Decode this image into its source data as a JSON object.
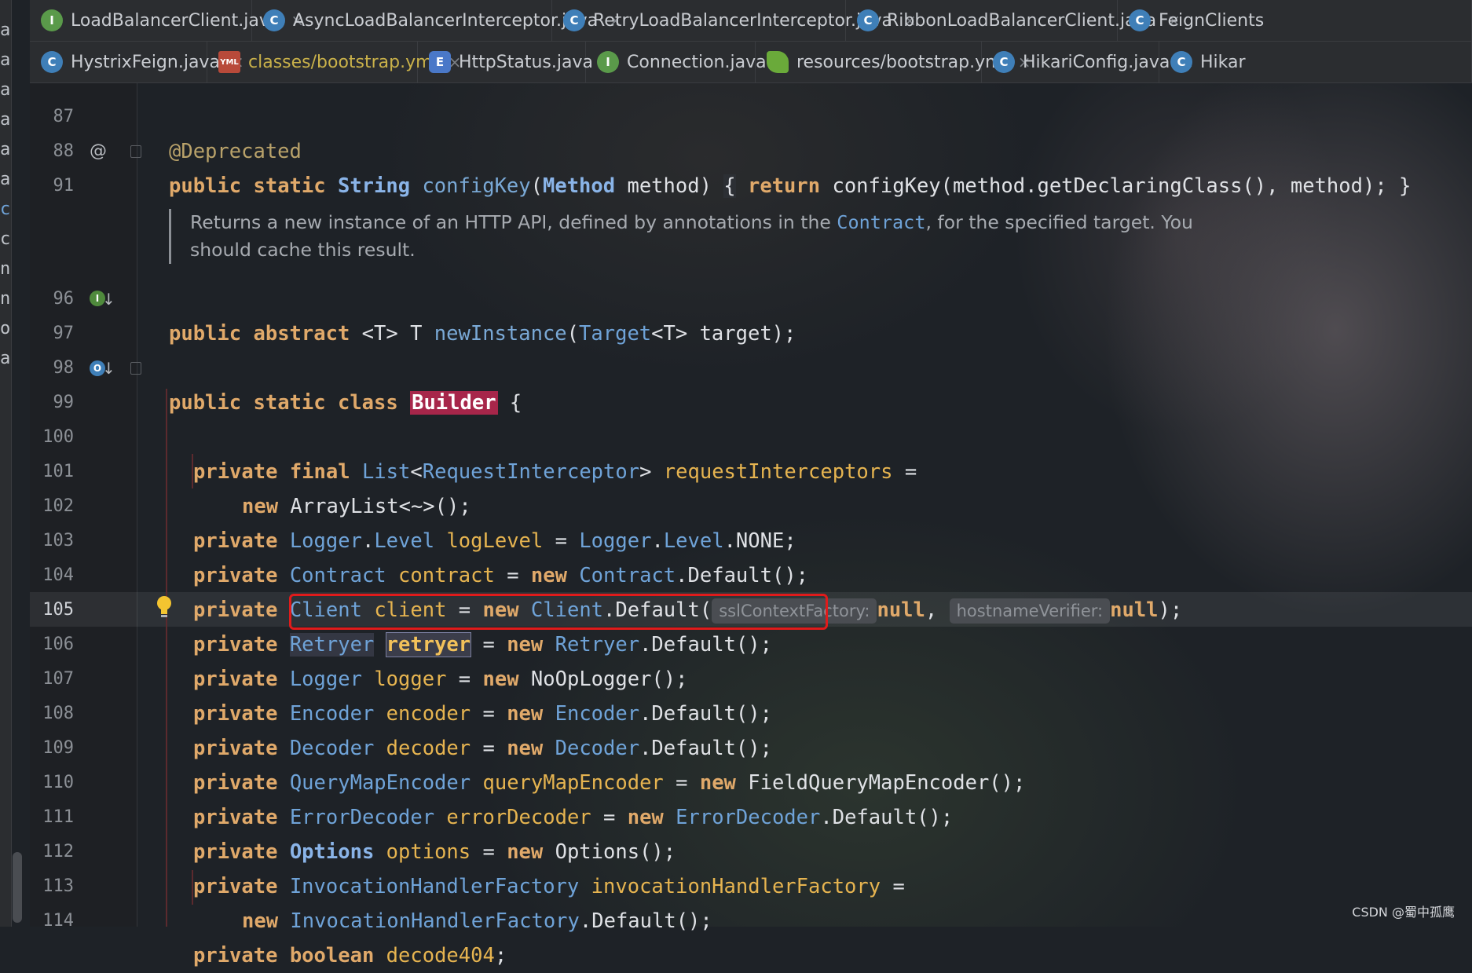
{
  "tabs_row1": [
    {
      "label": "LoadBalancerClient.java",
      "icon": "I"
    },
    {
      "label": "AsyncLoadBalancerInterceptor.java",
      "icon": "C"
    },
    {
      "label": "RetryLoadBalancerInterceptor.java",
      "icon": "C"
    },
    {
      "label": "RibbonLoadBalancerClient.java",
      "icon": "C"
    },
    {
      "label": "FeignClients",
      "icon": "C"
    }
  ],
  "tabs_row2": [
    {
      "label": "HystrixFeign.java",
      "icon": "C"
    },
    {
      "label": "classes/bootstrap.yml",
      "icon": "YML"
    },
    {
      "label": "HttpStatus.java",
      "icon": "E"
    },
    {
      "label": "Connection.java",
      "icon": "I"
    },
    {
      "label": "resources/bootstrap.yml",
      "icon": "leaf"
    },
    {
      "label": "HikariConfig.java",
      "icon": "C"
    },
    {
      "label": "Hikar",
      "icon": "C"
    }
  ],
  "close_glyph": "×",
  "left_strip_letters": [
    "a",
    "a",
    "a",
    "a",
    "a",
    "a",
    "c",
    "c",
    "n",
    "n",
    "o",
    "a"
  ],
  "line_numbers": [
    "87",
    "88",
    "91",
    "96",
    "97",
    "98",
    "99",
    "100",
    "101",
    "102",
    "103",
    "104",
    "105",
    "106",
    "107",
    "108",
    "109",
    "110",
    "111",
    "112",
    "113",
    "114"
  ],
  "code": {
    "l87_annotation": "@Deprecated",
    "l88": {
      "public": "public",
      "static": "static",
      "String": "String",
      "method_name": "configKey",
      "open": "(",
      "Method": "Method",
      "rest1": " method) ",
      "brace": "{",
      "return": "return",
      "rest2": " configKey(method.getDeclaringClass(), method); }"
    },
    "javadoc": {
      "before": "Returns a new instance of an HTTP API, defined by annotations in the ",
      "link": "Contract",
      "after": ", for the specified target. You should cache this result."
    },
    "l96": {
      "public": "public",
      "abstract": "abstract",
      "generic": " <T> T ",
      "method": "newInstance",
      "open": "(",
      "Target": "Target",
      "rest": "<T> target);"
    },
    "l98": {
      "public": "public",
      "static": "static",
      "class": "class",
      "name": "Builder",
      "rest": " {"
    },
    "l100": {
      "private": "private",
      "final": "final",
      "List": "List",
      "lt": "<",
      "RequestInterceptor": "RequestInterceptor",
      "gt": ">",
      "field": "requestInterceptors",
      "rest": " ="
    },
    "l101": {
      "new": "new",
      "rest": " ArrayList<~>();"
    },
    "l102": {
      "private": "private",
      "Logger": "Logger",
      "dot": ".",
      "Level": "Level",
      "field": "logLevel",
      "eq": " = ",
      "Logger2": "Logger",
      "dot2": ".",
      "Level2": "Level",
      "rest": ".NONE;"
    },
    "l103": {
      "private": "private",
      "Contract": "Contract",
      "field": "contract",
      "eq": " = ",
      "new": "new",
      "Contract2": "Contract",
      "rest": ".Default();"
    },
    "l104": {
      "private": "private",
      "Client": "Client",
      "field": "client",
      "eq": " = ",
      "new": "new",
      "Client2": "Client",
      "rest": ".Default(",
      "hint1": "sslContextFactory:",
      "null1": "null",
      "comma": ", ",
      "hint2": "hostnameVerifier:",
      "null2": "null",
      "end": ");"
    },
    "l105": {
      "private": "private",
      "Retryer": "Retryer",
      "field": "retryer",
      "eq": " = ",
      "new": "new",
      "Retryer2": "Retryer",
      "rest": ".Default();"
    },
    "l106": {
      "private": "private",
      "Logger": "Logger",
      "field": "logger",
      "eq": " = ",
      "new": "new",
      "rest": " NoOpLogger();"
    },
    "l107": {
      "private": "private",
      "Encoder": "Encoder",
      "field": "encoder",
      "eq": " = ",
      "new": "new",
      "Encoder2": "Encoder",
      "rest": ".Default();"
    },
    "l108": {
      "private": "private",
      "Decoder": "Decoder",
      "field": "decoder",
      "eq": " = ",
      "new": "new",
      "Decoder2": "Decoder",
      "rest": ".Default();"
    },
    "l109": {
      "private": "private",
      "QueryMapEncoder": "QueryMapEncoder",
      "field": "queryMapEncoder",
      "eq": " = ",
      "new": "new",
      "rest": " FieldQueryMapEncoder();"
    },
    "l110": {
      "private": "private",
      "ErrorDecoder": "ErrorDecoder",
      "field": "errorDecoder",
      "eq": " = ",
      "new": "new",
      "ErrorDecoder2": "ErrorDecoder",
      "rest": ".Default();"
    },
    "l111": {
      "private": "private",
      "Options": "Options",
      "field": "options",
      "eq": " = ",
      "new": "new",
      "rest": " Options();"
    },
    "l112": {
      "private": "private",
      "Type": "InvocationHandlerFactory",
      "field": "invocationHandlerFactory",
      "rest": " ="
    },
    "l113": {
      "new": "new",
      "Type": "InvocationHandlerFactory",
      "rest": ".Default();"
    },
    "l114": {
      "private": "private",
      "boolean": "boolean",
      "field": "decode404",
      "rest": ";"
    }
  },
  "gutter_icons": {
    "at_symbol": "@"
  },
  "watermark": "CSDN @蜀中孤鹰",
  "colors": {
    "highlight_box": "#e01b1b",
    "class_highlight": "#a7264a"
  }
}
